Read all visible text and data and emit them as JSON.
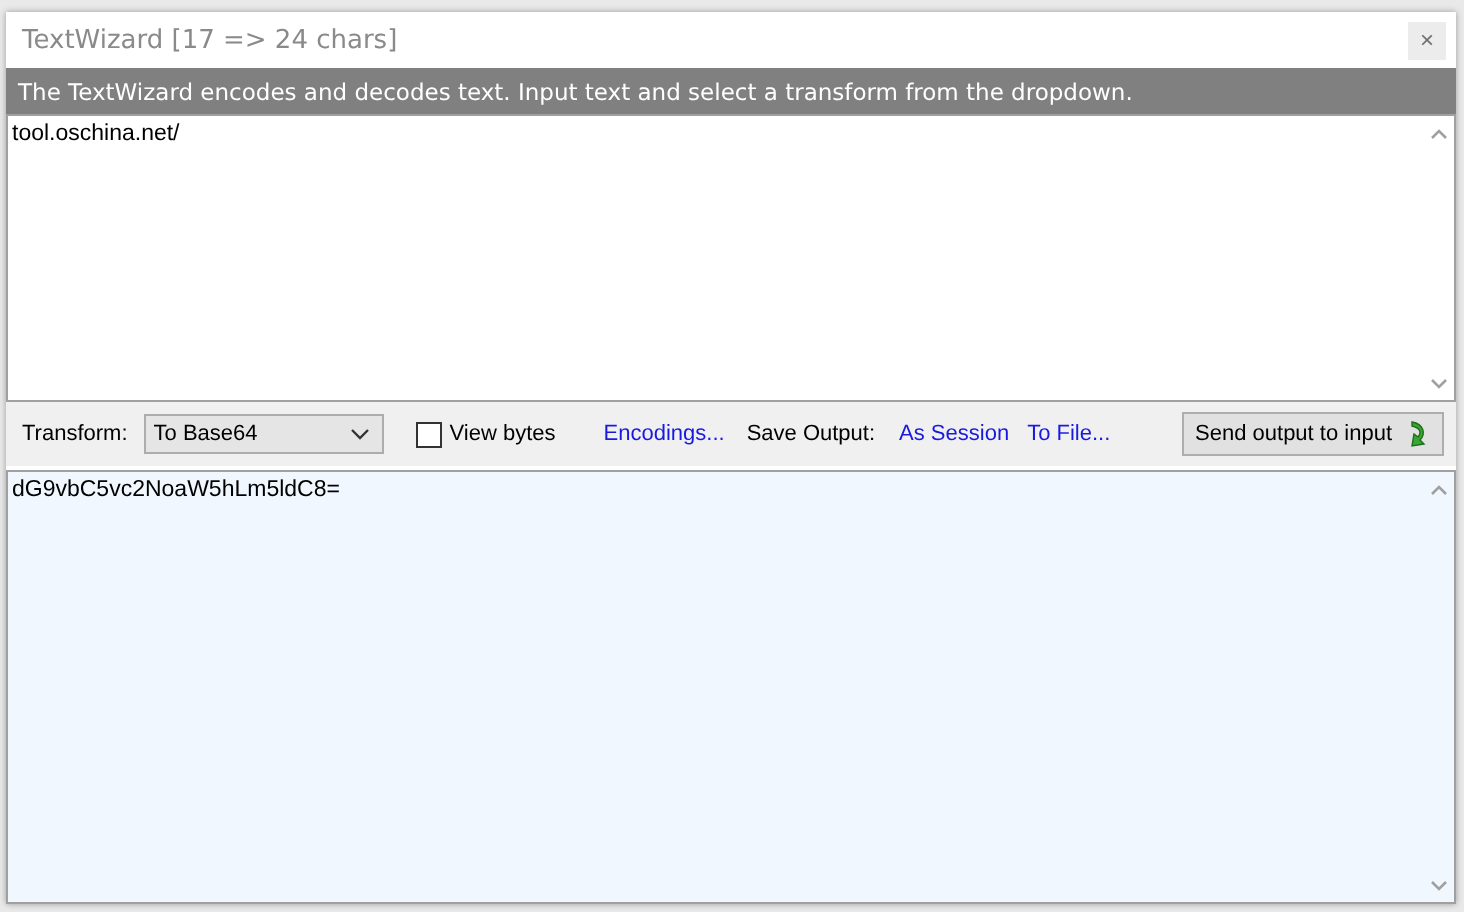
{
  "window": {
    "title": "TextWizard [17 => 24 chars]",
    "close": "×"
  },
  "description": "The TextWizard encodes and decodes text. Input text and select a transform from the dropdown.",
  "input": {
    "value": "tool.oschina.net/"
  },
  "toolbar": {
    "transform_label": "Transform:",
    "transform": {
      "value": "To Base64"
    },
    "view_bytes": {
      "label": "View bytes",
      "checked": false
    },
    "encodings_link": "Encodings...",
    "save_output_label": "Save Output:",
    "save_links": [
      "As Session",
      "To File..."
    ],
    "send_button": "Send output to input"
  },
  "output": {
    "value": "dG9vbC5vc2NoaW5hLm5ldC8="
  }
}
